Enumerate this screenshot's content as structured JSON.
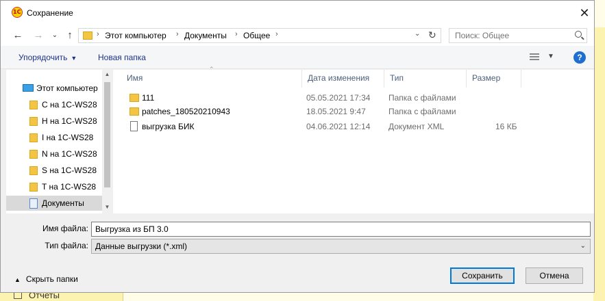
{
  "background": {
    "bottom_item": "Отчеты"
  },
  "window": {
    "title": "Сохранение",
    "close_label": "✕"
  },
  "nav": {
    "back_label": "←",
    "forward_label": "→",
    "recent_label": "⌄",
    "up_label": "↑",
    "breadcrumbs": [
      "Этот компьютер",
      "Документы",
      "Общее"
    ],
    "separator": "›",
    "search_placeholder": "Поиск: Общее"
  },
  "toolbar": {
    "organize_label": "Упорядочить",
    "new_folder_label": "Новая папка",
    "help_label": "?"
  },
  "tree": {
    "items": [
      {
        "label": "Этот компьютер",
        "icon": "pc-icon"
      },
      {
        "label": "C на 1C-WS28",
        "icon": "folder-icon"
      },
      {
        "label": "H на 1C-WS28",
        "icon": "folder-icon"
      },
      {
        "label": "I на 1C-WS28",
        "icon": "folder-icon"
      },
      {
        "label": "N на 1C-WS28",
        "icon": "folder-icon"
      },
      {
        "label": "S на 1C-WS28",
        "icon": "folder-icon"
      },
      {
        "label": "T на 1C-WS28",
        "icon": "folder-icon"
      },
      {
        "label": "Документы",
        "icon": "documents-icon",
        "selected": true
      }
    ]
  },
  "files": {
    "columns": [
      "Имя",
      "Дата изменения",
      "Тип",
      "Размер"
    ],
    "rows": [
      {
        "name": "111",
        "date": "05.05.2021 17:34",
        "type": "Папка с файлами",
        "size": "",
        "icon": "folder-icon"
      },
      {
        "name": "patches_180520210943",
        "date": "18.05.2021 9:47",
        "type": "Папка с файлами",
        "size": "",
        "icon": "folder-icon"
      },
      {
        "name": "выгрузка БИК",
        "date": "04.06.2021 12:14",
        "type": "Документ XML",
        "size": "16 КБ",
        "icon": "file-icon"
      }
    ]
  },
  "form": {
    "filename_label": "Имя файла:",
    "filename_value": "Выгрузка из БП 3.0",
    "filetype_label": "Тип файла:",
    "filetype_value": "Данные выгрузки (*.xml)",
    "hide_folders_label": "Скрыть папки",
    "save_label": "Сохранить",
    "cancel_label": "Отмена"
  },
  "colors": {
    "accent": "#0078d7",
    "link": "#1e3287",
    "folder": "#f4c542"
  }
}
